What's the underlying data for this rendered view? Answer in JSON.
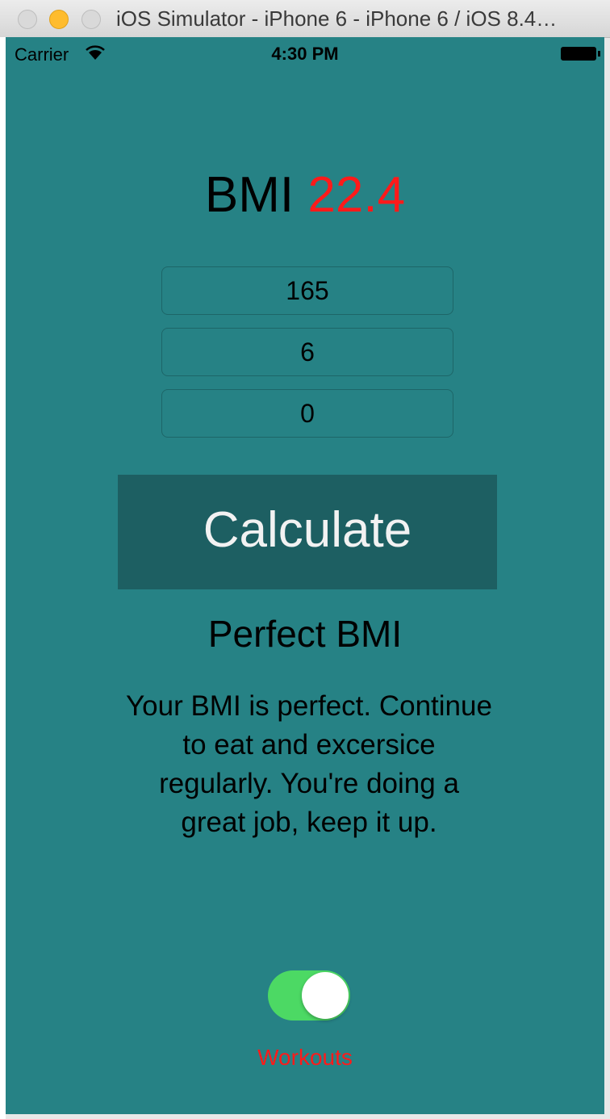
{
  "window": {
    "title": "iOS Simulator - iPhone 6 - iPhone 6 / iOS 8.4…"
  },
  "status_bar": {
    "carrier": "Carrier",
    "time": "4:30 PM"
  },
  "bmi": {
    "label": "BMI",
    "value": "22.4",
    "value_color": "#ff1a1a"
  },
  "inputs": {
    "weight": "165",
    "height_feet": "6",
    "height_inches": "0"
  },
  "calculate_button": {
    "label": "Calculate"
  },
  "result": {
    "title": "Perfect BMI",
    "message": "Your BMI is perfect. Continue to eat and excersice regularly. You're doing a great job, keep it up."
  },
  "workouts_toggle": {
    "label": "Workouts",
    "on": true,
    "on_color": "#4cd964"
  },
  "colors": {
    "background": "#268285",
    "button": "#1d5f62"
  }
}
